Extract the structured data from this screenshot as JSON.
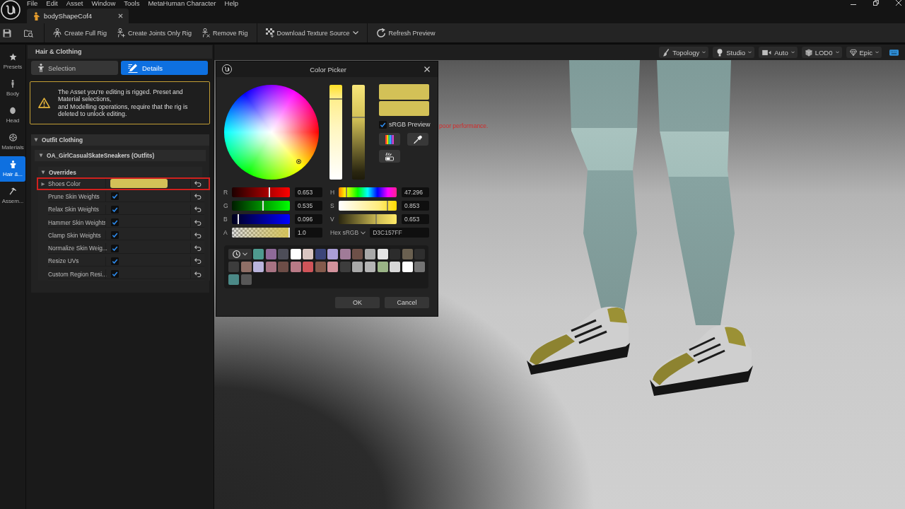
{
  "menu_bar": {
    "items": [
      "File",
      "Edit",
      "Asset",
      "Window",
      "Tools",
      "MetaHuman Character",
      "Help"
    ]
  },
  "document_tab": {
    "title": "bodyShapeCof4"
  },
  "toolbar": {
    "groups": [
      [
        {
          "label": "Create Full Rig",
          "kind": "fullrig",
          "dropdown": false
        },
        {
          "label": "Create Joints Only Rig",
          "kind": "jointsrig",
          "dropdown": false
        },
        {
          "label": "Remove Rig",
          "kind": "removerig",
          "dropdown": false
        }
      ],
      [
        {
          "label": "Download Texture Source",
          "kind": "texture",
          "dropdown": true
        }
      ],
      [
        {
          "label": "Refresh Preview",
          "kind": "refresh",
          "dropdown": false
        }
      ]
    ]
  },
  "nav_sidebar": {
    "items": [
      {
        "label": "Presets",
        "kind": "presets",
        "selected": false
      },
      {
        "label": "Body",
        "kind": "body",
        "selected": false
      },
      {
        "label": "Head",
        "kind": "head",
        "selected": false
      },
      {
        "label": "Materials",
        "kind": "materials",
        "selected": false
      },
      {
        "label": "Hair &...",
        "kind": "hair",
        "selected": true
      },
      {
        "label": "Assem...",
        "kind": "assembly",
        "selected": false
      }
    ]
  },
  "panel": {
    "title": "Hair & Clothing",
    "tabs": [
      {
        "label": "Selection",
        "kind": "selection",
        "selected": false
      },
      {
        "label": "Details",
        "kind": "details",
        "selected": true
      }
    ],
    "warning": {
      "message": "The Asset you're editing is rigged. Preset and Material selections,\nand Modelling operations, require that the rig is deleted to unlock editing."
    },
    "sections": [
      {
        "title": "Outfit Clothing",
        "expanded": true,
        "children": [
          {
            "title": "OA_GirlCasualSkateSneakers (Outfits)",
            "expanded": true,
            "children": [
              {
                "title": "Overrides",
                "expanded": true,
                "properties": [
                  {
                    "name": "Shoes Color",
                    "kind": "color",
                    "color": "#d3c157",
                    "expanded": false,
                    "highlighted": true
                  },
                  {
                    "name": "Prune Skin Weights",
                    "kind": "checkbox",
                    "checked": true,
                    "highlighted": false
                  },
                  {
                    "name": "Relax Skin Weights",
                    "kind": "checkbox",
                    "checked": true,
                    "highlighted": false
                  },
                  {
                    "name": "Hammer Skin Weights",
                    "kind": "checkbox",
                    "checked": true,
                    "highlighted": false
                  },
                  {
                    "name": "Clamp Skin Weights",
                    "kind": "checkbox",
                    "checked": true,
                    "highlighted": false
                  },
                  {
                    "name": "Normalize Skin Weig...",
                    "kind": "checkbox",
                    "checked": true,
                    "highlighted": false
                  },
                  {
                    "name": "Resize UVs",
                    "kind": "checkbox",
                    "checked": true,
                    "highlighted": false
                  },
                  {
                    "name": "Custom Region Resi...",
                    "kind": "checkbox",
                    "checked": true,
                    "highlighted": false
                  }
                ]
              }
            ]
          }
        ]
      }
    ]
  },
  "viewport": {
    "view_options": [
      {
        "label": "Topology",
        "kind": "topology"
      },
      {
        "label": "Studio",
        "kind": "lighting"
      },
      {
        "label": "Auto",
        "kind": "camera"
      },
      {
        "label": "LOD0",
        "kind": "lod"
      },
      {
        "label": "Epic",
        "kind": "quality"
      }
    ],
    "notice": "poor performance."
  },
  "color_picker": {
    "title": "Color Picker",
    "vertical_sliders": [
      {
        "kind": "saturation",
        "level": 0.853
      },
      {
        "kind": "value",
        "level": 0.653
      }
    ],
    "preview": [
      {
        "color": "#d3c157"
      },
      {
        "color": "#d3c157"
      }
    ],
    "srgb_preview": {
      "label": "sRGB Preview",
      "checked": true
    },
    "rgba_channels": [
      {
        "label": "R",
        "kind": "red",
        "level": 0.653,
        "reading": "0.653"
      },
      {
        "label": "G",
        "kind": "green",
        "level": 0.535,
        "reading": "0.535"
      },
      {
        "label": "B",
        "kind": "blue",
        "level": 0.096,
        "reading": "0.096"
      },
      {
        "label": "A",
        "kind": "alpha",
        "level": 1,
        "reading": "1.0"
      }
    ],
    "hsv_channels": [
      {
        "label": "H",
        "kind": "hue",
        "level": 0.131,
        "reading": "47.296"
      },
      {
        "label": "S",
        "kind": "saturation",
        "level": 0.853,
        "reading": "0.853"
      },
      {
        "label": "V",
        "kind": "value",
        "level": 0.653,
        "reading": "0.653"
      }
    ],
    "hex": {
      "label": "Hex sRGB",
      "value": "D3C157FF"
    },
    "recent_colors": [
      {
        "color": "#4e9a8e"
      },
      {
        "color": "#8f6a99"
      },
      {
        "color": "#4d4d58"
      },
      {
        "color": "#ffffff"
      },
      {
        "color": "#d9c6c2"
      },
      {
        "color": "#3b4579"
      },
      {
        "color": "#ab9ed6"
      },
      {
        "color": "#a07b98"
      },
      {
        "color": "#6e5048"
      },
      {
        "color": "#a9a9a9"
      },
      {
        "color": "#e4e4e4"
      },
      {
        "color": "#2c2c2c"
      },
      {
        "color": "#6a6050"
      },
      {
        "color": "#2e2e2e"
      },
      {
        "color": "#3c3c3c"
      },
      {
        "color": "#8f6f66"
      },
      {
        "color": "#bab4dc"
      },
      {
        "color": "#a87383"
      },
      {
        "color": "#6d4d47"
      },
      {
        "color": "#b97a86"
      },
      {
        "color": "#d05459"
      },
      {
        "color": "#845a4c"
      },
      {
        "color": "#d3929c"
      },
      {
        "color": "#3d3d3d"
      },
      {
        "color": "#a8a8a8"
      },
      {
        "color": "#b4b4b4"
      },
      {
        "color": "#9ab486"
      },
      {
        "color": "#d8d8d8"
      },
      {
        "color": "#fefefe"
      },
      {
        "color": "#737373"
      },
      {
        "color": "#4b8987"
      },
      {
        "color": "#575757"
      }
    ],
    "buttons": [
      {
        "label": "OK"
      },
      {
        "label": "Cancel"
      }
    ]
  }
}
